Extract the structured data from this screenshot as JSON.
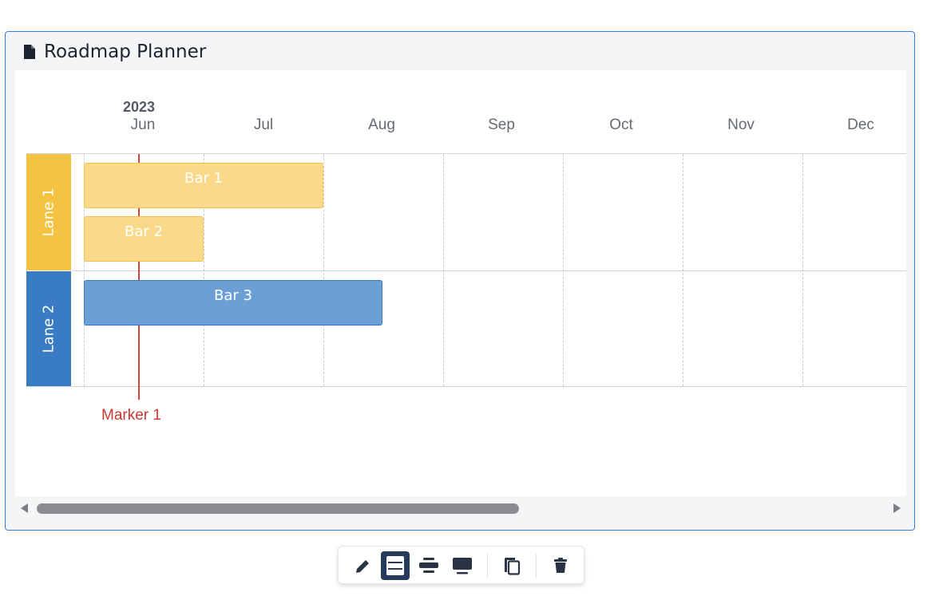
{
  "panel": {
    "title": "Roadmap Planner",
    "icon": "document-icon",
    "border_color": "#2f7de1"
  },
  "timeline": {
    "year": "2023",
    "months": [
      "Jun",
      "Jul",
      "Aug",
      "Sep",
      "Oct",
      "Nov",
      "Dec"
    ]
  },
  "lanes": [
    {
      "label": "Lane 1",
      "color": "#f5c342"
    },
    {
      "label": "Lane 2",
      "color": "#3a7cc4"
    }
  ],
  "bars": [
    {
      "label": "Bar 1",
      "lane": "Lane 1",
      "start": "Jun",
      "end": "Aug",
      "color": "#fbd98a"
    },
    {
      "label": "Bar 2",
      "lane": "Lane 1",
      "start": "Jun",
      "end": "Jul",
      "color": "#fbd98a"
    },
    {
      "label": "Bar 3",
      "lane": "Lane 2",
      "start": "Jun",
      "end": "Aug",
      "color": "#6b9fd6"
    }
  ],
  "marker": {
    "label": "Marker 1",
    "color": "#d2443b"
  },
  "toolbar": {
    "buttons": [
      {
        "name": "edit-icon",
        "active": false
      },
      {
        "name": "large-view-icon",
        "active": true
      },
      {
        "name": "medium-view-icon",
        "active": false
      },
      {
        "name": "screen-view-icon",
        "active": false
      },
      {
        "name": "copy-icon",
        "active": false
      },
      {
        "name": "delete-icon",
        "active": false
      }
    ]
  }
}
